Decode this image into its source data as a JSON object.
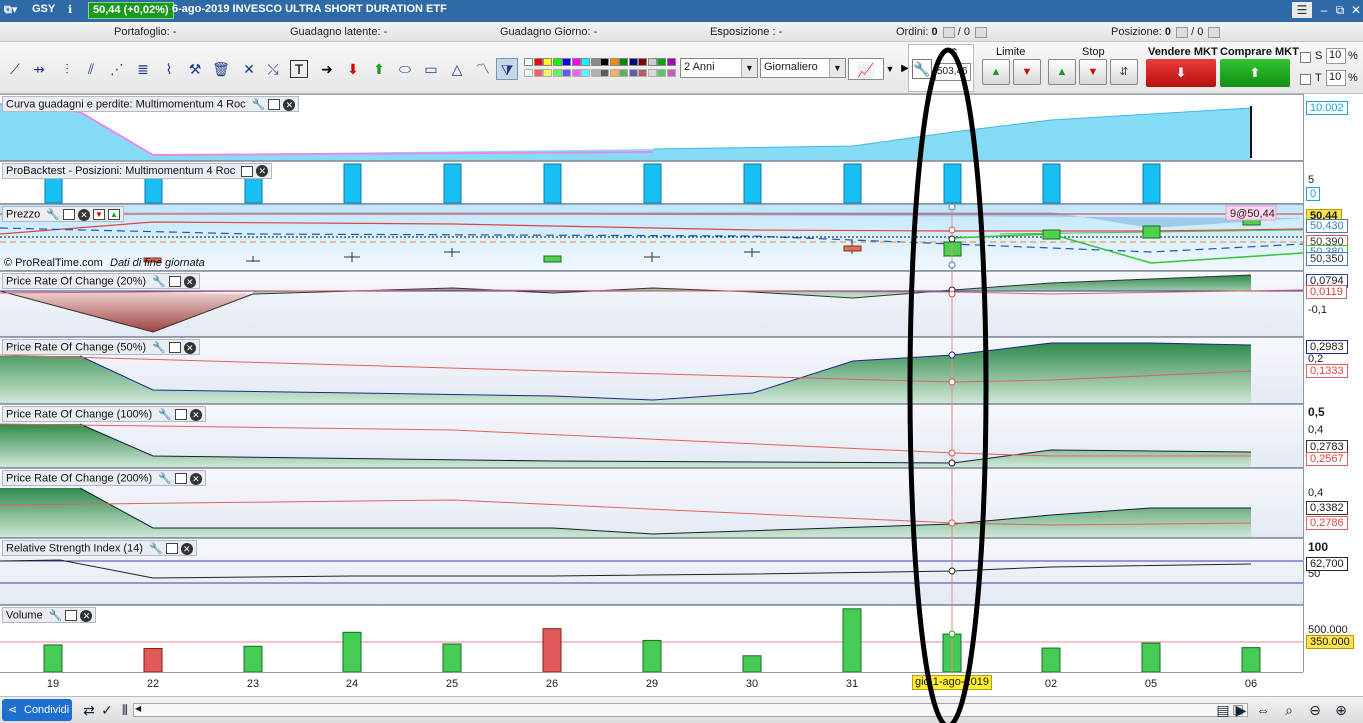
{
  "titlebar": {
    "symbol": "GSY",
    "quote": "50,44 (+0,02%)",
    "title": "6-ago-2019 INVESCO ULTRA SHORT DURATION ETF"
  },
  "portfolio_bar": {
    "portafoglio": "Portafoglio: -",
    "guadagno_latente": "Guadagno latente: -",
    "guadagno_giorno": "Guadagno Giorno: -",
    "esposizione": "Esposizione : -",
    "ordini_label": "Ordini:",
    "ordini_value": "0",
    "ordini_sep": "/ 0",
    "posizione_label": "Posizione:",
    "posizione_value": "0",
    "posizione_sep": "/ 0"
  },
  "toolbar": {
    "period": "2 Anni",
    "timeframe": "Giornaliero",
    "amount_label": "$",
    "amount_value": "503,46",
    "limite_label": "Limite",
    "stop_label": "Stop",
    "sell_label": "Vendere MKT",
    "buy_label": "Comprare MKT",
    "s_label": "S",
    "t_label": "T",
    "s_value": "10",
    "t_value": "10",
    "pct": "%",
    "colors": [
      "#ffffff",
      "#ff0000",
      "#ffff00",
      "#00ff00",
      "#0000ff",
      "#ff00ff",
      "#00ffff",
      "#888888",
      "#000000",
      "#ff8800",
      "#008800",
      "#000088",
      "#880000",
      "#cccccc",
      "#00aa00",
      "#aa00aa"
    ]
  },
  "panels": {
    "pnl": {
      "title": "Curva guadagni e perdite: Multimomentum 4 Roc"
    },
    "backtest": {
      "title": "ProBacktest - Posizioni: Multimomentum 4 Roc"
    },
    "price": {
      "title": "Prezzo",
      "credit": "© ProRealTime.com",
      "credit2": "Dati di fine giornata",
      "order_tag": "9@50,44"
    },
    "roc20": {
      "title": "Price Rate Of Change (20%)"
    },
    "roc50": {
      "title": "Price Rate Of Change (50%)"
    },
    "roc100": {
      "title": "Price Rate Of Change (100%)"
    },
    "roc200": {
      "title": "Price Rate Of Change (200%)"
    },
    "rsi": {
      "title": "Relative Strength Index (14)"
    },
    "volume": {
      "title": "Volume"
    }
  },
  "yaxis": {
    "pnl_value": "10.002",
    "bt_5": "5",
    "bt_0": "0",
    "price_last": "50,44",
    "price_430": "50,430",
    "price_390": "50,390",
    "price_380": "50,380",
    "price_350": "50,350",
    "roc20_a": "0,0794",
    "roc20_b": "0,0119",
    "roc20_c": "-0,1",
    "roc50_a": "0,2983",
    "roc50_b": "0,2",
    "roc50_c": "0,1333",
    "roc100_top": "0,5",
    "roc100_a": "0,4",
    "roc100_b": "0,2783",
    "roc100_c": "0,2567",
    "roc200_a": "0,4",
    "roc200_b": "0,3382",
    "roc200_c": "0,2786",
    "rsi_top": "100",
    "rsi_a": "62,700",
    "rsi_b": "50",
    "vol_a": "500.000",
    "vol_b": "350.000"
  },
  "xaxis": {
    "labels": [
      "19",
      "22",
      "23",
      "24",
      "25",
      "26",
      "29",
      "30",
      "31",
      "02",
      "05",
      "06"
    ],
    "cursor": "gio 1-ago-2019"
  },
  "bottom": {
    "share": "Condividi"
  },
  "chart_data": {
    "type": "bar",
    "categories": [
      "19",
      "22",
      "23",
      "24",
      "25",
      "26",
      "29",
      "30",
      "31",
      "1-ago",
      "02",
      "05",
      "06"
    ],
    "series": [
      {
        "name": "Volume",
        "values": [
          300000,
          260000,
          285000,
          440000,
          310000,
          480000,
          350000,
          180000,
          700000,
          420000,
          265000,
          320000,
          270000
        ],
        "colors": [
          "up",
          "down",
          "up",
          "up",
          "up",
          "down",
          "up",
          "up",
          "up",
          "up",
          "up",
          "up",
          "up"
        ]
      }
    ]
  }
}
